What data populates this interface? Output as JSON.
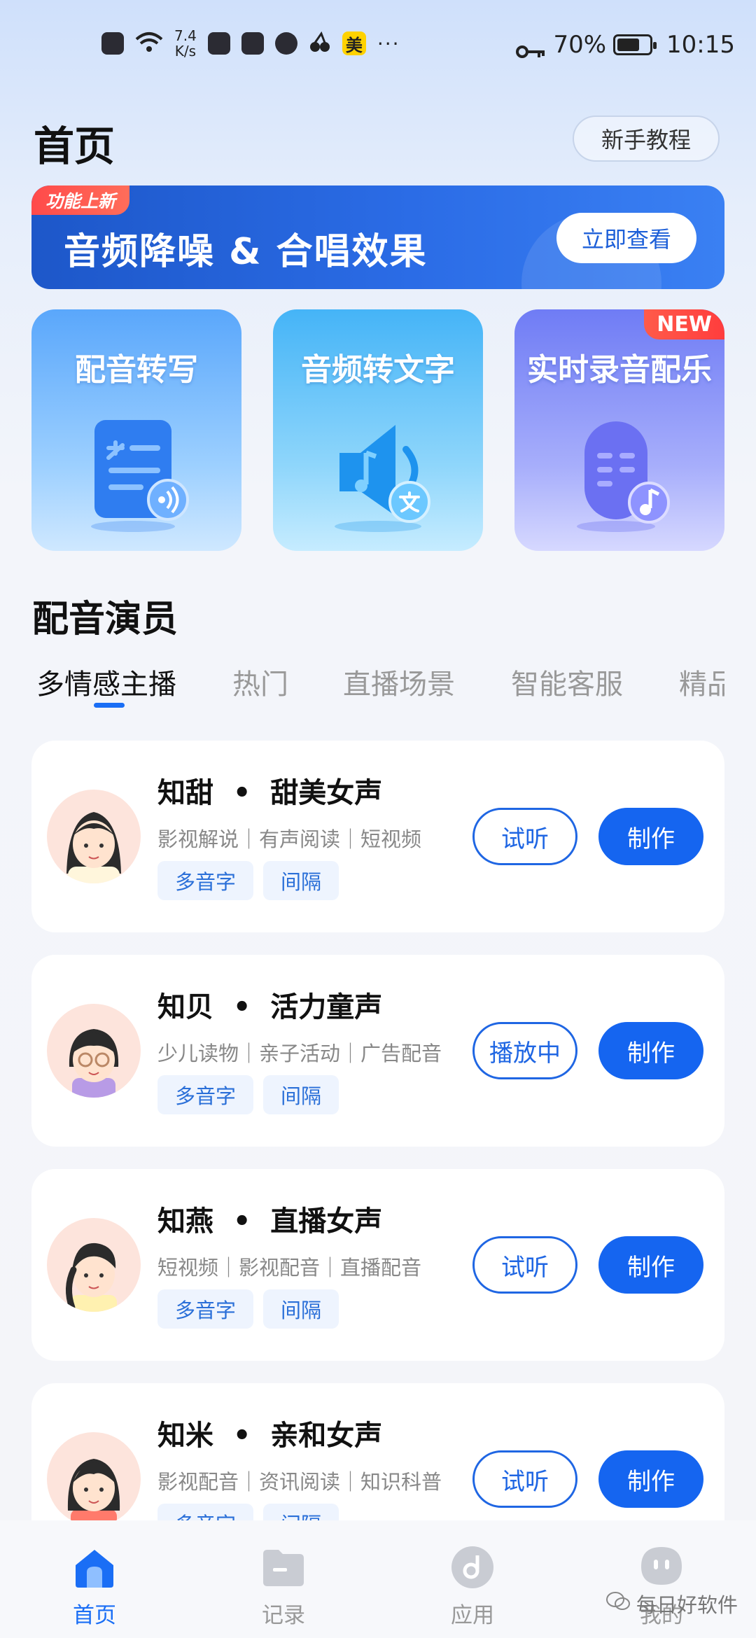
{
  "status_bar": {
    "net_speed": "7.4",
    "net_unit": "K/s",
    "store_badge": "美",
    "more": "···",
    "battery": "70%",
    "battery_level": 0.7,
    "time": "10:15"
  },
  "header": {
    "title": "首页",
    "tutorial_label": "新手教程"
  },
  "banner": {
    "badge": "功能上新",
    "title": "音频降噪 & 合唱效果",
    "button_label": "立即查看"
  },
  "features": [
    {
      "title": "配音转写",
      "icon": "document-voice-icon"
    },
    {
      "title": "音频转文字",
      "icon": "speaker-text-icon"
    },
    {
      "title": "实时录音配乐",
      "icon": "microphone-music-icon",
      "badge": "NEW"
    }
  ],
  "section": {
    "title": "配音演员",
    "tabs": [
      "多情感主播",
      "热门",
      "直播场景",
      "智能客服",
      "精品"
    ],
    "active_tab": 0
  },
  "voices": [
    {
      "name": "知甜",
      "style": "甜美女声",
      "tags": "影视解说｜有声阅读｜短视频",
      "labels": [
        "多音字",
        "间隔"
      ],
      "listen_label": "试听",
      "make_label": "制作"
    },
    {
      "name": "知贝",
      "style": "活力童声",
      "tags": "少儿读物｜亲子活动｜广告配音",
      "labels": [
        "多音字",
        "间隔"
      ],
      "listen_label": "播放中",
      "make_label": "制作"
    },
    {
      "name": "知燕",
      "style": "直播女声",
      "tags": "短视频｜影视配音｜直播配音",
      "labels": [
        "多音字",
        "间隔"
      ],
      "listen_label": "试听",
      "make_label": "制作"
    },
    {
      "name": "知米",
      "style": "亲和女声",
      "tags": "影视配音｜资讯阅读｜知识科普",
      "labels": [
        "多音字",
        "间隔"
      ],
      "listen_label": "试听",
      "make_label": "制作"
    }
  ],
  "bottom_nav": [
    {
      "label": "首页",
      "icon": "home-icon",
      "active": true
    },
    {
      "label": "记录",
      "icon": "folder-icon",
      "active": false
    },
    {
      "label": "应用",
      "icon": "music-disc-icon",
      "active": false
    },
    {
      "label": "我的",
      "icon": "profile-icon",
      "active": false
    }
  ],
  "watermark": "每日好软件",
  "colors": {
    "accent": "#1565f0",
    "badge_red": "#ff4a4a",
    "tag_bg": "#eef4fe"
  }
}
